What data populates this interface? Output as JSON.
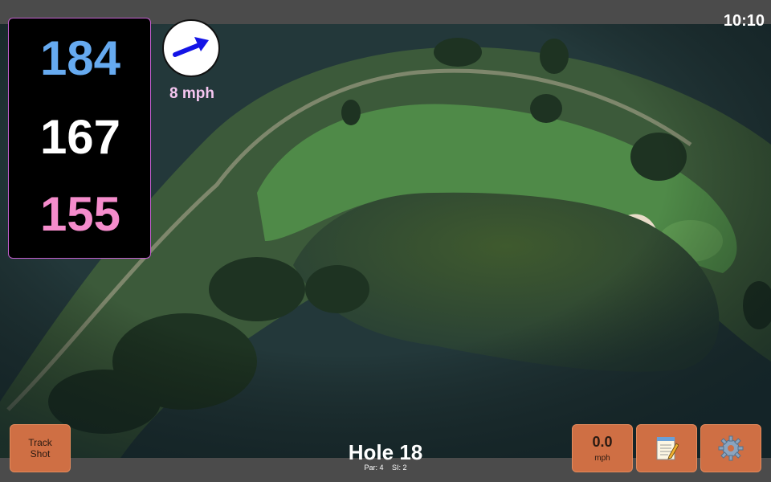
{
  "status": {
    "clock": "10:10"
  },
  "distances": {
    "back": "184",
    "middle": "167",
    "front": "155"
  },
  "wind": {
    "speed_label": "8 mph",
    "icon": "wind-direction-arrow-icon"
  },
  "hole": {
    "title": "Hole 18",
    "par": "Par: 4",
    "stroke_index": "SI: 2"
  },
  "buttons": {
    "track_shot": {
      "line1": "Track",
      "line2": "Shot"
    },
    "speed": {
      "value": "0.0",
      "unit": "mph"
    },
    "notes": {
      "icon": "notepad-icon"
    },
    "settings": {
      "icon": "gear-icon"
    }
  },
  "colors": {
    "back_distance": "#66aaf0",
    "middle_distance": "#ffffff",
    "front_distance": "#f58ccc",
    "button": "#cf6f44",
    "panel_border": "#c45fd0"
  }
}
